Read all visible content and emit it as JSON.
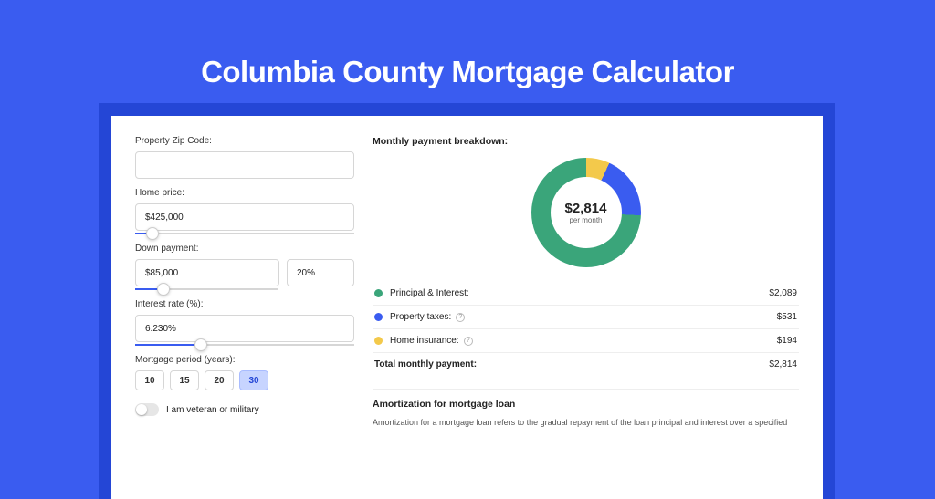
{
  "header_title": "Columbia County Mortgage Calculator",
  "form": {
    "zip_label": "Property Zip Code:",
    "zip_value": "",
    "price_label": "Home price:",
    "price_value": "$425,000",
    "price_slider_pct": 8,
    "down_label": "Down payment:",
    "down_value": "$85,000",
    "down_pct_value": "20%",
    "down_slider_pct": 20,
    "rate_label": "Interest rate (%):",
    "rate_value": "6.230%",
    "rate_slider_pct": 30,
    "period_label": "Mortgage period (years):",
    "periods": [
      "10",
      "15",
      "20",
      "30"
    ],
    "period_active_index": 3,
    "veteran_label": "I am veteran or military"
  },
  "breakdown": {
    "title": "Monthly payment breakdown:",
    "center_value": "$2,814",
    "center_sub": "per month",
    "rows": [
      {
        "label": "Principal & Interest:",
        "value": "$2,089",
        "color": "#3aa57a",
        "info": false
      },
      {
        "label": "Property taxes:",
        "value": "$531",
        "color": "#3a5cf0",
        "info": true
      },
      {
        "label": "Home insurance:",
        "value": "$194",
        "color": "#f3c94b",
        "info": true
      }
    ],
    "total_label": "Total monthly payment:",
    "total_value": "$2,814"
  },
  "amortization": {
    "title": "Amortization for mortgage loan",
    "body": "Amortization for a mortgage loan refers to the gradual repayment of the loan principal and interest over a specified"
  },
  "chart_data": {
    "type": "pie",
    "title": "Monthly payment breakdown",
    "series": [
      {
        "name": "Principal & Interest",
        "value": 2089,
        "color": "#3aa57a"
      },
      {
        "name": "Property taxes",
        "value": 531,
        "color": "#3a5cf0"
      },
      {
        "name": "Home insurance",
        "value": 194,
        "color": "#f3c94b"
      }
    ],
    "total": 2814,
    "center_label": "$2,814 per month"
  }
}
